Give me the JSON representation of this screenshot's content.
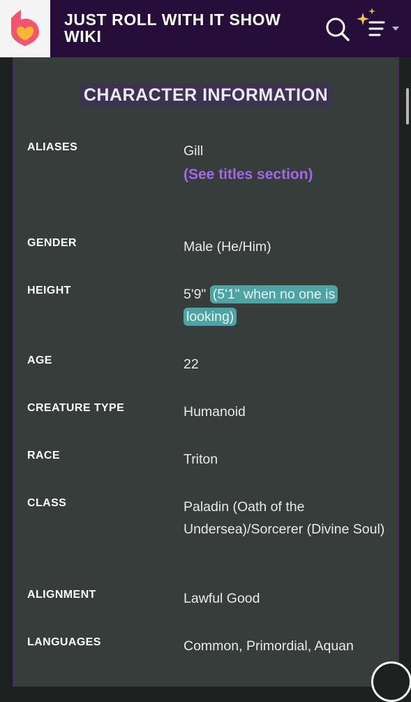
{
  "header": {
    "site_title": "JUST ROLL WITH IT SHOW WIKI",
    "logo_icon": "fandom-heart-logo-icon",
    "search_icon": "search-icon",
    "menu_icon": "sparkle-menu-icon"
  },
  "colors": {
    "topbar": "#260d3a",
    "panel": "#363d3a",
    "link": "#a268e6",
    "highlight": "#4ea3a3"
  },
  "infobox": {
    "title": "CHARACTER INFORMATION",
    "rows": [
      {
        "label": "ALIASES",
        "value": "Gill",
        "link": "(See titles section)"
      },
      {
        "label": "GENDER",
        "value": "Male (He/Him)"
      },
      {
        "label": "HEIGHT",
        "value": "5'9\"",
        "highlight": "(5'1\" when no one is looking)"
      },
      {
        "label": "AGE",
        "value": "22"
      },
      {
        "label": "CREATURE TYPE",
        "value": "Humanoid"
      },
      {
        "label": "RACE",
        "value": "Triton"
      },
      {
        "label": "CLASS",
        "value": "Paladin (Oath of the Undersea)/Sorcerer (Divine Soul)"
      },
      {
        "label": "ALIGNMENT",
        "value": "Lawful Good"
      },
      {
        "label": "LANGUAGES",
        "value": "Common, Primordial, Aquan"
      }
    ]
  }
}
